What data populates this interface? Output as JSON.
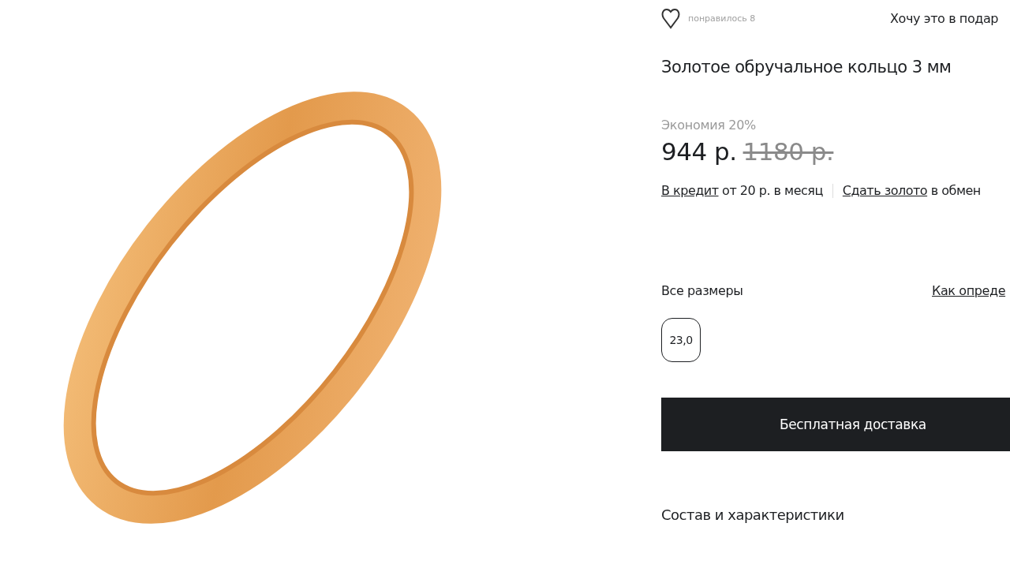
{
  "likes": {
    "label": "понравилось 8"
  },
  "gift_link": "Хочу это в подар",
  "product": {
    "title": "Золотое обручальное кольцо 3 мм"
  },
  "price": {
    "savings": "Экономия 20%",
    "current": "944 р.",
    "old": "1180 р."
  },
  "credit": {
    "link": "В кредит",
    "text": "от 20 р. в месяц"
  },
  "trade_in": {
    "link": "Сдать золото",
    "text": "в обмен"
  },
  "sizes": {
    "label": "Все размеры",
    "guide_link": "Как опреде",
    "items": [
      {
        "label": "23,0",
        "selected": true
      }
    ]
  },
  "delivery_button": "Бесплатная доставка",
  "section_title": "Состав и характеристики"
}
